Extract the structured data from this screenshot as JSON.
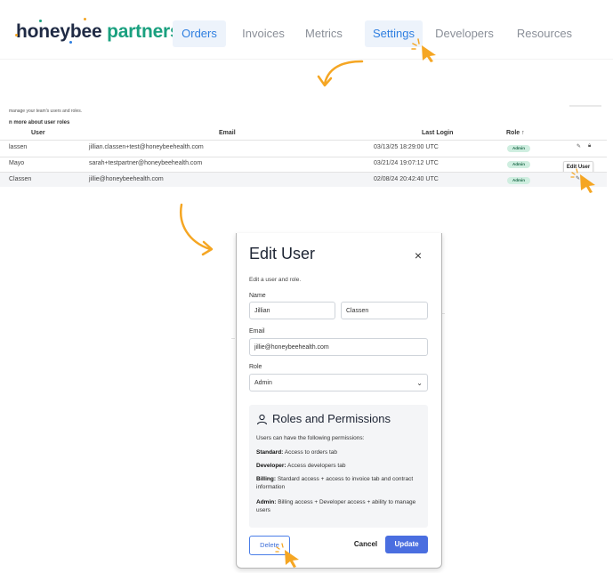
{
  "nav": {
    "brand_part1": "honeybee",
    "brand_part2": " partners",
    "items": [
      "Orders",
      "Invoices",
      "Metrics",
      "Settings",
      "Developers",
      "Resources"
    ]
  },
  "users": {
    "subtitle": "manage your team's users and roles.",
    "learn_more": "n more about user roles",
    "headers": {
      "user": "User",
      "email": "Email",
      "last_login": "Last Login",
      "role": "Role ↑"
    },
    "rows": [
      {
        "user": "lassen",
        "email": "jillian.classen+test@honeybeehealth.com",
        "last_login": "03/13/25 18:29:00 UTC",
        "role": "Admin"
      },
      {
        "user": "Mayo",
        "email": "sarah+testpartner@honeybeehealth.com",
        "last_login": "03/21/24 19:07:12 UTC",
        "role": "Admin"
      },
      {
        "user": "Classen",
        "email": "jillie@honeybeehealth.com",
        "last_login": "02/08/24 20:42:40 UTC",
        "role": "Admin"
      }
    ],
    "tooltip": "Edit User"
  },
  "modal": {
    "title": "Edit User",
    "close": "×",
    "subtitle": "Edit a user and role.",
    "name_label": "Name",
    "first_name": "Jillian",
    "last_name": "Classen",
    "email_label": "Email",
    "email_value": "jillie@honeybeehealth.com",
    "role_label": "Role",
    "role_value": "Admin",
    "permissions": {
      "title": "Roles and Permissions",
      "intro": "Users can have the following permissions:",
      "items": [
        {
          "name": "Standard:",
          "desc": " Access to orders tab"
        },
        {
          "name": "Developer:",
          "desc": " Access developers tab"
        },
        {
          "name": "Billing:",
          "desc": " Stardard access + access to invoice tab and contract information"
        },
        {
          "name": "Admin:",
          "desc": " Billing access + Developer access + ability to manage users"
        }
      ]
    },
    "delete_label": "Delete",
    "cancel_label": "Cancel",
    "update_label": "Update"
  },
  "colors": {
    "accent_orange": "#f5a623",
    "brand_green": "#1aa07f",
    "primary_blue": "#4a6ee0"
  },
  "icons": [
    "cursor-pointer-icon",
    "click-sparkle-icon",
    "curved-arrow-icon",
    "edit-icon",
    "lock-icon",
    "close-icon",
    "user-icon",
    "chevron-down-icon"
  ]
}
